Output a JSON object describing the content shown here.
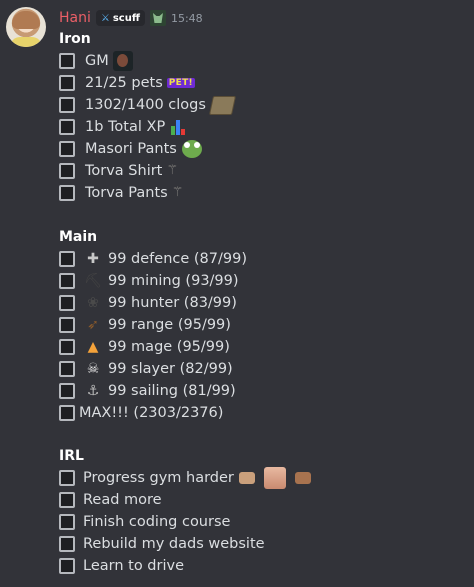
{
  "message": {
    "username": "Hani",
    "server_tag": "scuff",
    "server_tag_icon": "sword-icon",
    "clan_icon": "mask-icon",
    "timestamp": "15:48",
    "name_color": "#ea5f67"
  },
  "sections": {
    "iron": {
      "title": "Iron",
      "items": [
        {
          "label": "GM",
          "icon": "gm-portrait-icon"
        },
        {
          "label": "21/25 pets",
          "badge": "PET!",
          "icon": "pet-icon"
        },
        {
          "label": "1302/1400 clogs",
          "icon": "collection-log-book-icon"
        },
        {
          "label": "1b Total XP",
          "icon": "stats-bar-chart-icon"
        },
        {
          "label": "Masori Pants",
          "icon": "frog-emoji-icon"
        },
        {
          "label": "Torva Shirt",
          "icon": "scythe-icon"
        },
        {
          "label": "Torva Pants",
          "icon": "scythe-icon"
        }
      ]
    },
    "main": {
      "title": "Main",
      "items": [
        {
          "label": "99 defence (87/99)",
          "icon": "defence-skill-icon"
        },
        {
          "label": "99 mining (93/99)",
          "icon": "mining-skill-icon"
        },
        {
          "label": "99 hunter (83/99)",
          "icon": "hunter-skill-icon"
        },
        {
          "label": "99 range (95/99)",
          "icon": "ranged-skill-icon"
        },
        {
          "label": "99 mage (95/99)",
          "icon": "magic-skill-icon"
        },
        {
          "label": "99 slayer (82/99)",
          "icon": "slayer-skill-icon"
        },
        {
          "label": "99 sailing (81/99)",
          "icon": "sailing-anchor-icon"
        },
        {
          "label": "MAX!!! (2303/2376)",
          "icon": ""
        }
      ]
    },
    "irl": {
      "title": "IRL",
      "items": [
        {
          "label": "Progress gym harder",
          "icon": "flexed-biceps-icon"
        },
        {
          "label": "Read more"
        },
        {
          "label": "Finish coding course"
        },
        {
          "label": "Rebuild my dads website"
        },
        {
          "label": "Learn to drive"
        }
      ]
    }
  }
}
